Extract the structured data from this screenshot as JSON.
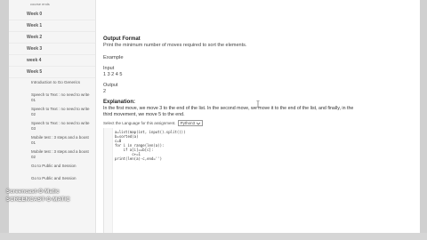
{
  "sidebar": {
    "top_item": "course ends",
    "weeks": [
      "Week 0",
      "Week 1",
      "Week 2",
      "Week 3",
      "week 4",
      "Week 5"
    ],
    "sub_items": [
      "Introduction to Go Generics",
      "Speech to Text : no need to write 01",
      "Speech to Text : no need to write 02",
      "Speech to Text : no need to write 03",
      "Mobile test : 3 steps and a boost 01",
      "Mobile test : 3 steps and a boost 02",
      "Go to Public and Session",
      "Go to Public and Session"
    ]
  },
  "problem": {
    "output_format_heading": "Output Format",
    "output_format_text": "Print the minimum number of moves required to sort the elements.",
    "example_heading": "Example",
    "input_label": "Input",
    "input_value": "1 3 2 4 5",
    "output_label": "Output",
    "output_value": "2",
    "explanation_heading": "Explanation:",
    "explanation_text": "In the first move, we move 3 to the end of the list. In the second move, we move it to the end of the list, and finally, in the third movement, we move 5 to the end."
  },
  "editor": {
    "language_prompt": "Select the Language for this assignment.",
    "language_selected": "Python3",
    "code_lines": [
      "a=list(map(int, input().split()))",
      "b=sorted(a)",
      "c=0",
      "for i in range(len(a)):",
      "    if a[i]==b[c]:",
      "        c+=1",
      "print(len(a)-c,end='')"
    ]
  },
  "watermark": {
    "line1": "Screencast-O-Matic",
    "line2": "SCREENCAST-O-MATIC"
  }
}
